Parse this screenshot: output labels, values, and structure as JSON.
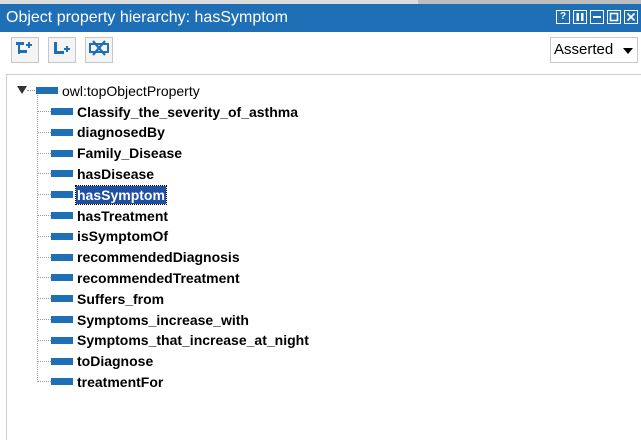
{
  "window": {
    "title": "Object property hierarchy: hasSymptom",
    "accent_color": "#1f6fb6",
    "buttons": [
      "help-icon",
      "pin-icon",
      "minimize-icon",
      "maximize-icon",
      "close-icon"
    ]
  },
  "toolbar": {
    "buttons": [
      {
        "icon": "add-subproperty-icon"
      },
      {
        "icon": "add-sibling-property-icon"
      },
      {
        "icon": "delete-property-icon"
      }
    ],
    "view_select": {
      "value": "Asserted"
    }
  },
  "tree": {
    "root": {
      "label": "owl:topObjectProperty"
    },
    "selected": "hasSymptom",
    "items": [
      {
        "label": "Classify_the_severity_of_asthma"
      },
      {
        "label": "diagnosedBy"
      },
      {
        "label": "Family_Disease"
      },
      {
        "label": "hasDisease"
      },
      {
        "label": "hasSymptom"
      },
      {
        "label": "hasTreatment"
      },
      {
        "label": "isSymptomOf"
      },
      {
        "label": "recommendedDiagnosis"
      },
      {
        "label": "recommendedTreatment"
      },
      {
        "label": "Suffers_from"
      },
      {
        "label": "Symptoms_increase_with"
      },
      {
        "label": "Symptoms_that_increase_at_night"
      },
      {
        "label": "toDiagnose"
      },
      {
        "label": "treatmentFor"
      }
    ]
  }
}
